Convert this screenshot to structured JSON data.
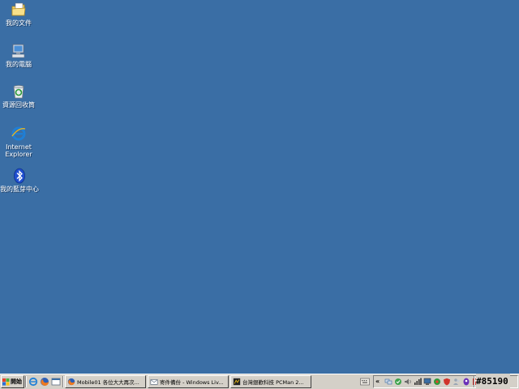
{
  "desktop": {
    "background": "#3a6ea5",
    "icons": [
      {
        "label": "我的文件",
        "icon": "my-documents-folder-icon"
      },
      {
        "label": "我的電腦",
        "icon": "my-computer-icon"
      },
      {
        "label": "資源回收筒",
        "icon": "recycle-bin-icon"
      },
      {
        "label": "Internet\nExplorer",
        "icon": "internet-explorer-icon"
      },
      {
        "label": "我的藍芽中心",
        "icon": "bluetooth-icon"
      }
    ]
  },
  "taskbar": {
    "start_label": "開始",
    "quick_launch": [
      "internet-explorer-icon",
      "firefox-icon",
      "show-desktop-icon"
    ],
    "tasks": [
      {
        "label": "Mobile01 各位大大再次...",
        "icon": "firefox-icon"
      },
      {
        "label": "寄件備份 - Windows Liv...",
        "icon": "mail-icon"
      },
      {
        "label": "台灣銀歡科技 PCMan 2...",
        "icon": "pcman-icon"
      }
    ],
    "tray_chevron": "«",
    "tray_icons": [
      "network-icon",
      "security-icon",
      "volume-icon",
      "signal-icon",
      "display-icon",
      "antivirus-icon",
      "shield-icon",
      "messenger-icon",
      "yahoo-icon",
      "update-icon"
    ],
    "badge": "#85190"
  }
}
